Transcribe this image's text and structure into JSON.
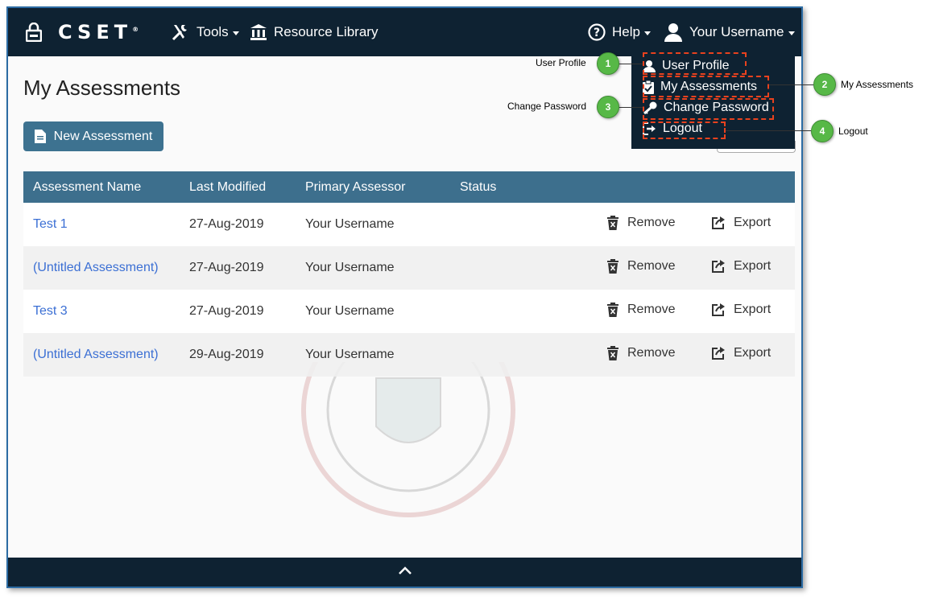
{
  "header": {
    "logo_text": "CSET",
    "logo_mark": "®",
    "tools_label": "Tools",
    "library_label": "Resource Library",
    "help_label": "Help",
    "user_label": "Your Username"
  },
  "page": {
    "title": "My Assessments",
    "new_button": "New Assessment"
  },
  "table": {
    "columns": [
      "Assessment Name",
      "Last Modified",
      "Primary Assessor",
      "Status"
    ],
    "rows": [
      {
        "name": "Test 1",
        "modified": "27-Aug-2019",
        "assessor": "Your Username",
        "status": "",
        "remove": "Remove",
        "export": "Export"
      },
      {
        "name": "(Untitled Assessment)",
        "modified": "27-Aug-2019",
        "assessor": "Your Username",
        "status": "",
        "remove": "Remove",
        "export": "Export"
      },
      {
        "name": "Test 3",
        "modified": "27-Aug-2019",
        "assessor": "Your Username",
        "status": "",
        "remove": "Remove",
        "export": "Export"
      },
      {
        "name": "(Untitled Assessment)",
        "modified": "29-Aug-2019",
        "assessor": "Your Username",
        "status": "",
        "remove": "Remove",
        "export": "Export"
      }
    ]
  },
  "user_menu": {
    "items": [
      {
        "label": "User Profile",
        "icon": "user-icon"
      },
      {
        "label": "My Assessments",
        "icon": "clipboard-check-icon"
      },
      {
        "label": "Change Password",
        "icon": "key-icon"
      },
      {
        "label": "Logout",
        "icon": "logout-icon"
      }
    ]
  },
  "callouts": [
    {
      "number": "1",
      "label": "User Profile"
    },
    {
      "number": "2",
      "label": "My Assessments"
    },
    {
      "number": "3",
      "label": "Change Password"
    },
    {
      "number": "4",
      "label": "Logout"
    }
  ],
  "colors": {
    "nav_bg": "#0e2232",
    "table_header": "#3d6f8d",
    "button": "#3d7290",
    "link": "#3b6fd4",
    "callout": "#57b847",
    "highlight": "#e8421e"
  }
}
